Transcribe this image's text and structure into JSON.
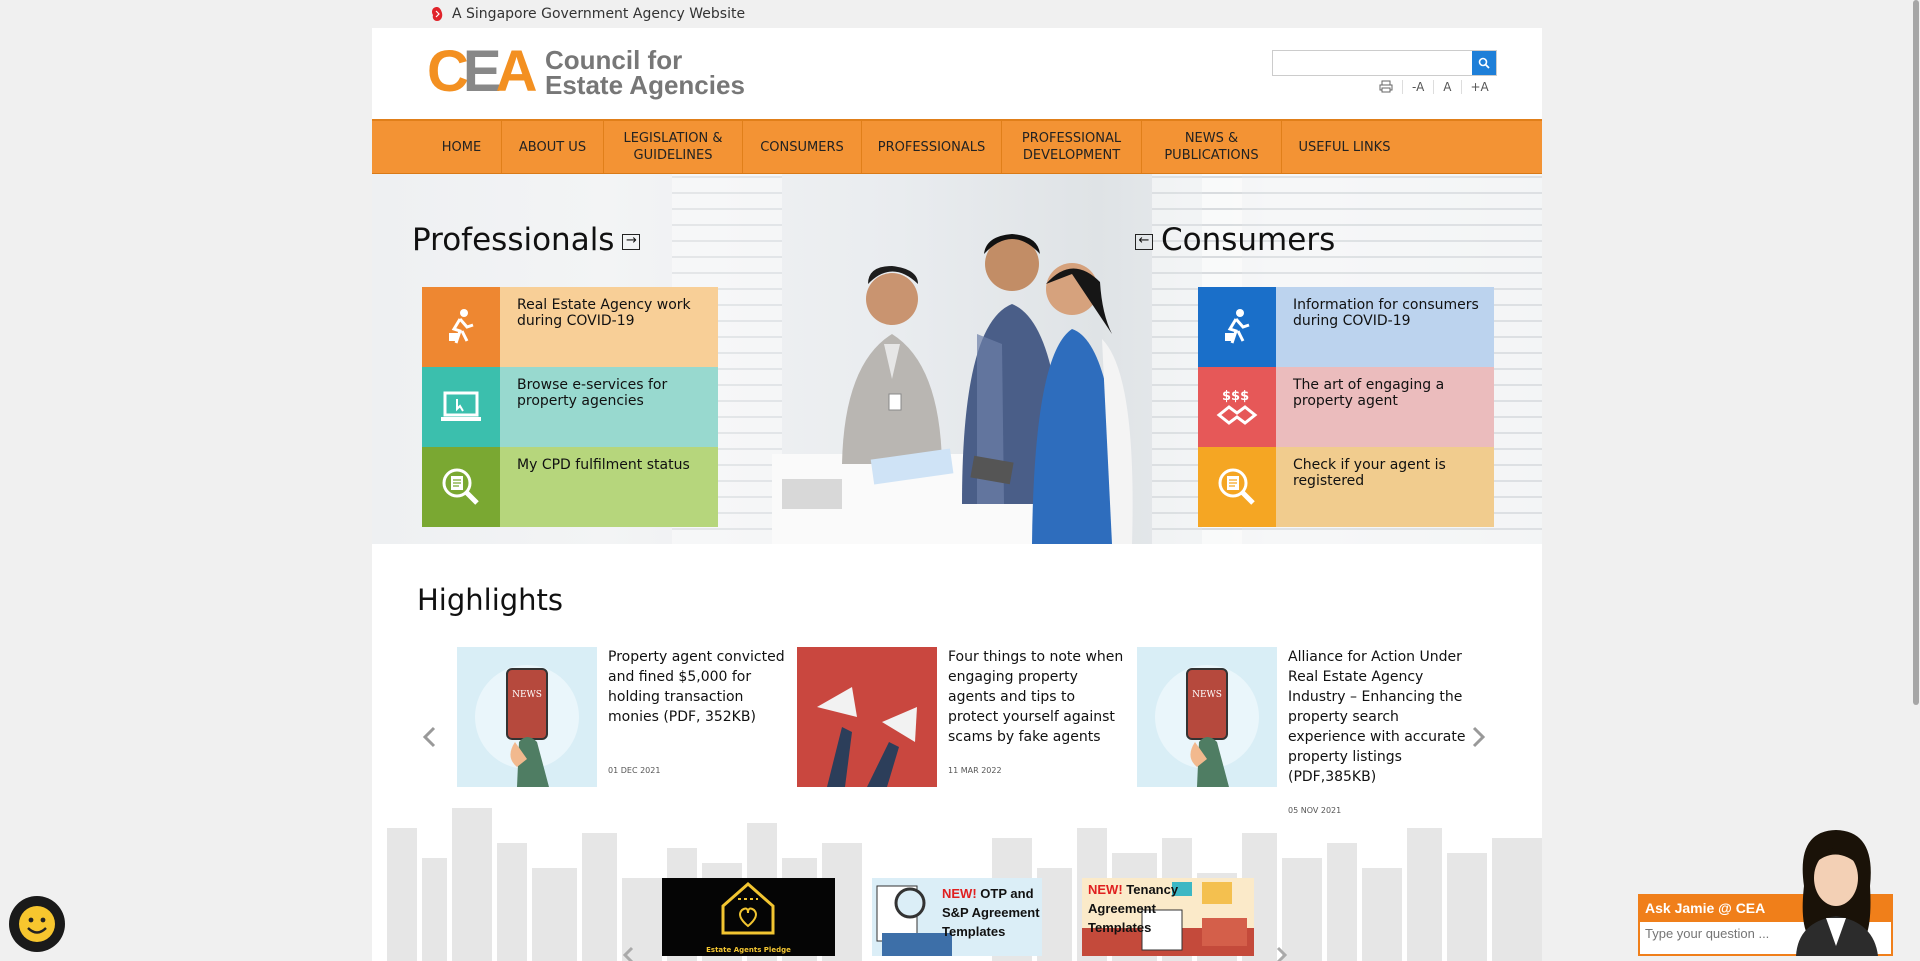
{
  "gov_banner": {
    "text": "A Singapore Government Agency Website"
  },
  "logo": {
    "mark": "CEA",
    "name_line1": "Council for",
    "name_line2": "Estate Agencies"
  },
  "search": {
    "placeholder": "",
    "value": ""
  },
  "tools": {
    "print": "print-icon",
    "decrease": "-A",
    "normal": "A",
    "increase": "+A"
  },
  "nav": [
    {
      "label": "HOME"
    },
    {
      "label": "ABOUT US"
    },
    {
      "label": "LEGISLATION & GUIDELINES"
    },
    {
      "label": "CONSUMERS"
    },
    {
      "label": "PROFESSIONALS"
    },
    {
      "label": "PROFESSIONAL DEVELOPMENT"
    },
    {
      "label": "NEWS & PUBLICATIONS"
    },
    {
      "label": "USEFUL LINKS"
    }
  ],
  "hero": {
    "professionals_title": "Professionals",
    "consumers_title": "Consumers",
    "professionals": [
      {
        "label": "Real Estate Agency work during COVID-19",
        "icon": "runner-icon",
        "icon_bg": "#ee8731",
        "bg": "#f8cf97"
      },
      {
        "label": "Browse e-services for property agencies",
        "icon": "laptop-icon",
        "icon_bg": "#3bbfad",
        "bg": "#98d9cf"
      },
      {
        "label": "My CPD fulfilment status",
        "icon": "magnifier-document-icon",
        "icon_bg": "#7aa832",
        "bg": "#b6d67c"
      }
    ],
    "consumers": [
      {
        "label": "Information for consumers during COVID-19",
        "icon": "runner-icon",
        "icon_bg": "#1a6fc9",
        "bg": "#bcd3ee"
      },
      {
        "label": "The art of engaging a property agent",
        "icon": "handshake-money-icon",
        "icon_bg": "#e65858",
        "bg": "#ebbcbd"
      },
      {
        "label": "Check if your agent is registered",
        "icon": "magnifier-document-icon",
        "icon_bg": "#f5a623",
        "bg": "#f1cc8e"
      }
    ]
  },
  "highlights": {
    "title": "Highlights",
    "items": [
      {
        "title": "Property agent convicted and fined $5,000 for holding transaction monies (PDF, 352KB)",
        "date": "01 DEC 2021",
        "thumb": "news-phone"
      },
      {
        "title": "Four things to note when engaging property agents and tips to protect yourself against scams by fake agents",
        "date": "11 MAR 2022",
        "thumb": "megaphones"
      },
      {
        "title": "Alliance for Action Under Real Estate Agency Industry – Enhancing the property search experience with accurate property listings (PDF,385KB)",
        "date": "05 NOV 2021",
        "thumb": "news-phone"
      }
    ]
  },
  "banners": [
    {
      "label": "Estate Agents Pledge"
    },
    {
      "label_new": "NEW!",
      "label": "OTP and S&P Agreement Templates"
    },
    {
      "label_new": "NEW!",
      "label": "Tenancy Agreement Templates"
    }
  ],
  "chatbot": {
    "title": "Ask Jamie @ CEA",
    "placeholder": "Type your question ..."
  },
  "colors": {
    "brand_orange": "#f39334",
    "nav_border": "#e07f1a",
    "search_btn": "#1e7fd8"
  }
}
